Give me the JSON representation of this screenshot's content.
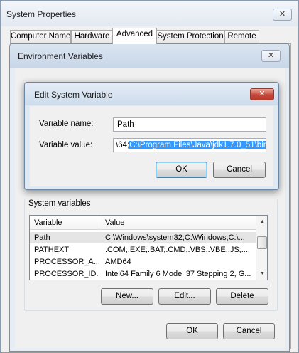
{
  "system_properties": {
    "title": "System Properties",
    "close_glyph": "✕",
    "tabs": [
      "Computer Name",
      "Hardware",
      "Advanced",
      "System Protection",
      "Remote"
    ],
    "active_tab": "Advanced"
  },
  "env_vars": {
    "title": "Environment Variables",
    "close_glyph": "✕",
    "system_variables_label": "System variables",
    "columns": [
      "Variable",
      "Value"
    ],
    "rows": [
      {
        "variable": "Path",
        "value": "C:\\Windows\\system32;C:\\Windows;C:\\..."
      },
      {
        "variable": "PATHEXT",
        "value": ".COM;.EXE;.BAT;.CMD;.VBS;.VBE;.JS;...."
      },
      {
        "variable": "PROCESSOR_A...",
        "value": "AMD64"
      },
      {
        "variable": "PROCESSOR_ID...",
        "value": "Intel64 Family 6 Model 37 Stepping 2, G..."
      }
    ],
    "buttons": {
      "new": "New...",
      "edit": "Edit...",
      "delete": "Delete"
    },
    "ok": "OK",
    "cancel": "Cancel"
  },
  "edit_dialog": {
    "title": "Edit System Variable",
    "close_glyph": "✕",
    "name_label": "Variable name:",
    "name_value": "Path",
    "value_label": "Variable value:",
    "value_prefix": "\\64;",
    "value_selected": "C:\\Program Files\\Java\\jdk1.7.0_51\\bin",
    "ok": "OK",
    "cancel": "Cancel"
  },
  "icons": {
    "scroll_up": "▲",
    "scroll_down": "▼"
  }
}
